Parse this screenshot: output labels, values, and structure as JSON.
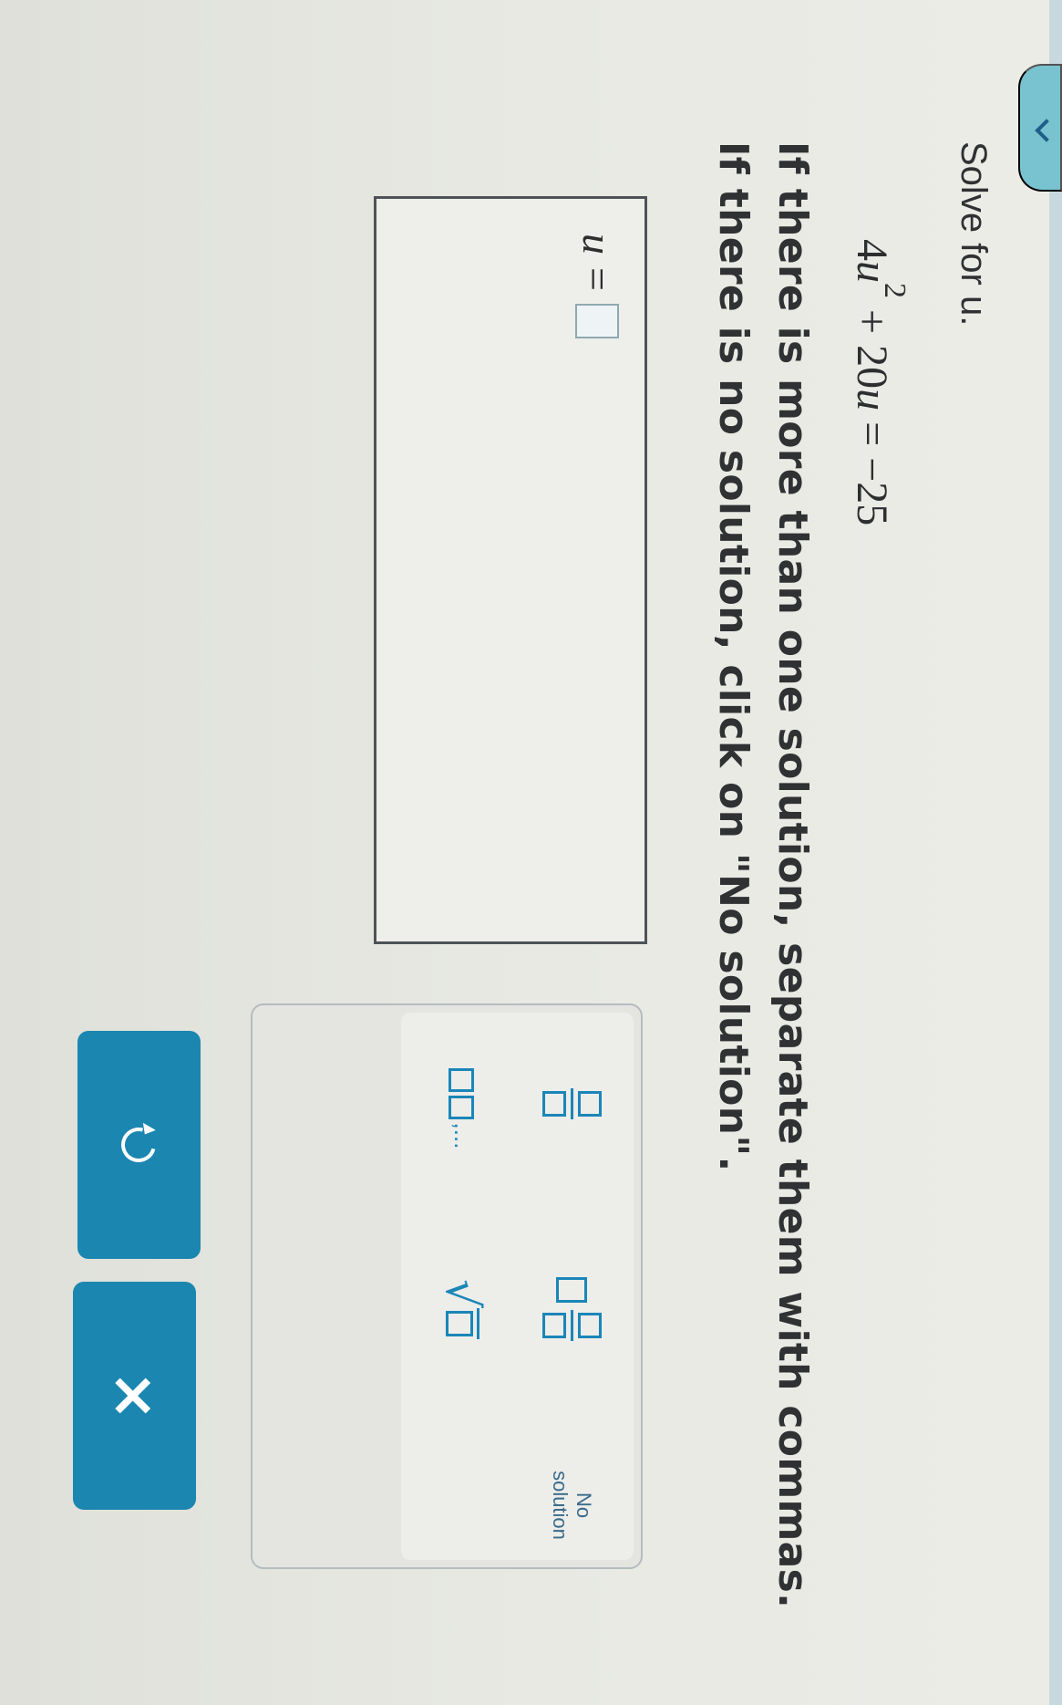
{
  "question": {
    "prompt": "Solve for u.",
    "equation": {
      "coef": "4",
      "var": "u",
      "exp": "2",
      "rest": " + 20",
      "rhs": " = −25"
    },
    "instruction_1": "If there is more than one solution, separate them with commas.",
    "instruction_2": "If there is no solution, click on \"No solution\"."
  },
  "answer": {
    "variable": "u",
    "equals": "=",
    "value": ""
  },
  "keypad": {
    "list_dots": ",...",
    "no_solution_label": "No",
    "no_solution_label_2": "solution",
    "undo_icon": "undo-icon",
    "clear_icon": "close-icon"
  },
  "colors": {
    "accent": "#1b86b0",
    "key_blue": "#1b86b8",
    "text": "#2f3133"
  }
}
